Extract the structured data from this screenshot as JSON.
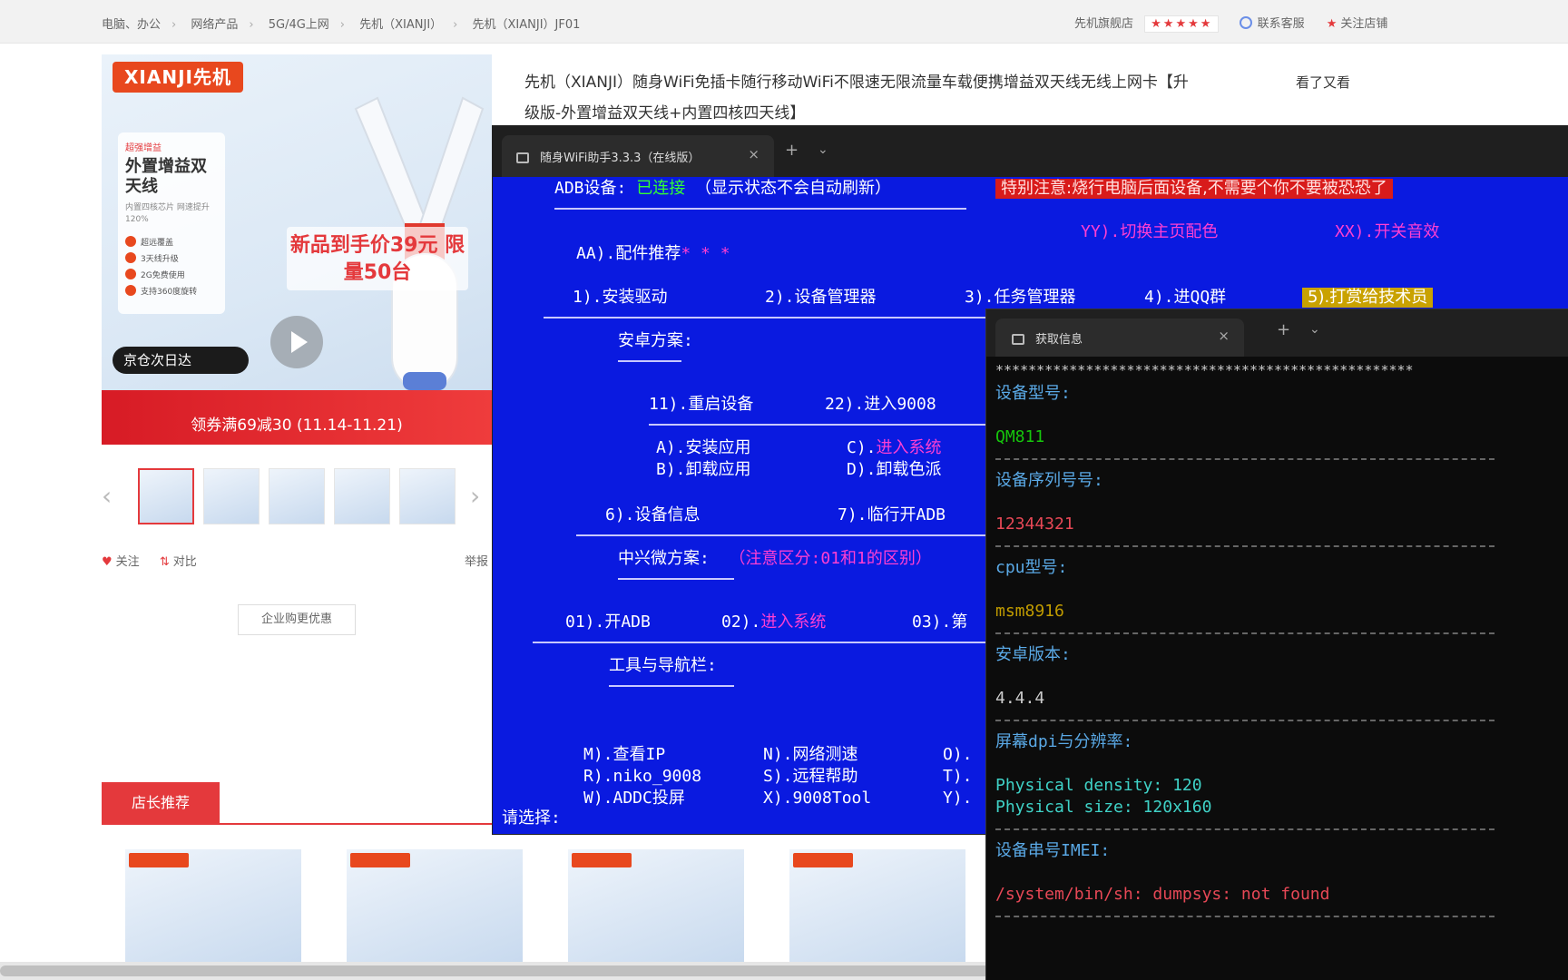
{
  "store": {
    "breadcrumb": [
      "电脑、办公",
      "网络产品",
      "5G/4G上网",
      "先机（XIANJI）",
      "先机（XIANJI）JF01"
    ],
    "seller_label": "先机旗舰店",
    "rating_stars": "★★★★★",
    "contact_label": "联系客服",
    "follow_label": "关注店铺",
    "logo_text": "XIANJI先机",
    "spec_tag": "超强增益",
    "spec_title": "外置增益双天线",
    "spec_sub": "内置四核芯片 网速提升120%",
    "spec_features": [
      "超远覆盖",
      "3天线升级",
      "2G免费使用",
      "支持360度旋转"
    ],
    "promo_text": "新品到手价39元 限量50台",
    "jd_badge": "京仓次日达",
    "coupon_text": "领券满69减30 (11.14-11.21)",
    "thumb_left_arrow": "‹",
    "thumb_right_arrow": "›",
    "follow_item": "关注",
    "compare_item": "对比",
    "report_item": "举报",
    "enterprise_button": "企业购更优惠",
    "shop_recommend_tab": "店长推荐",
    "product_title": "先机（XIANJI）随身WiFi免插卡随行移动WiFi不限速无限流量车载便携增益双天线无线上网卡【升级版-外置增益双天线+内置四核四天线】",
    "seen_label": "看了又看"
  },
  "term1": {
    "tab_title": "随身WiFi助手3.3.3（在线版）",
    "tab_close": "×",
    "tab_add": "+",
    "tab_menu": "⌄",
    "adb_label": "ADB设备:",
    "adb_status": "已连接",
    "adb_note": "（显示状态不会自动刷新）",
    "warning": "特别注意:烧行电脑后面设备,不需要个你不要被恐恐了",
    "opt_yy": "YY).切换主页配色",
    "opt_xx": "XX).开关音效",
    "opt_aa": "AA).配件推荐",
    "aa_stars": "* * *",
    "menu1": [
      "1).安装驱动",
      "2).设备管理器",
      "3).任务管理器",
      "4).进QQ群"
    ],
    "menu1_highlight": "5).打赏给技术员",
    "android_header": "安卓方案:",
    "opt_11": "11).重启设备",
    "opt_22": "22).进入9008",
    "opt_a": "A).安装应用",
    "opt_c": "C).",
    "opt_c_mag": "进入系统",
    "opt_b": "B).卸载应用",
    "opt_d": "D).卸载色派",
    "opt_6": "6).设备信息",
    "opt_7": "7).临行开ADB",
    "zx_header": "中兴微方案:",
    "zx_note": "（注意区分:01和1的区别）",
    "opt_01": "01).开ADB",
    "opt_02": "02).",
    "opt_02_mag": "进入系统",
    "opt_03": "03).",
    "opt_03_cut": "第",
    "tools_header": "工具与导航栏:",
    "tools_row1": [
      "M).查看IP",
      "N).网络测速",
      "O)."
    ],
    "tools_row2": [
      "R).niko_9008",
      "S).远程帮助",
      "T)."
    ],
    "tools_row3": [
      "W).ADDC投屏",
      "X).9008Tool",
      "Y)."
    ],
    "prompt": "请选择:"
  },
  "term2": {
    "tab_title": "获取信息",
    "tab_close": "×",
    "tab_add": "+",
    "tab_menu": "⌄",
    "stars_line": "***************************************************",
    "model_label": "设备型号:",
    "model_value": "QM811",
    "serial_label": "设备序列号号:",
    "serial_value": "12344321",
    "cpu_label": "cpu型号:",
    "cpu_value": "msm8916",
    "android_label": "安卓版本:",
    "android_value": "4.4.4",
    "dpi_label": "屏幕dpi与分辨率:",
    "density_value": "Physical density: 120",
    "size_value": "Physical size: 120x160",
    "imei_label": "设备串号IMEI:",
    "imei_value": "/system/bin/sh: dumpsys: not found"
  },
  "colors": {
    "jd_red": "#e4393c",
    "term1_bg": "#0a1ae0",
    "term2_bg": "#0c0c0c"
  },
  "icons": [
    "chevron-left-icon",
    "chevron-right-icon",
    "heart-icon",
    "star-icon",
    "play-icon",
    "terminal-icon",
    "close-icon",
    "plus-icon",
    "chevron-down-icon"
  ]
}
